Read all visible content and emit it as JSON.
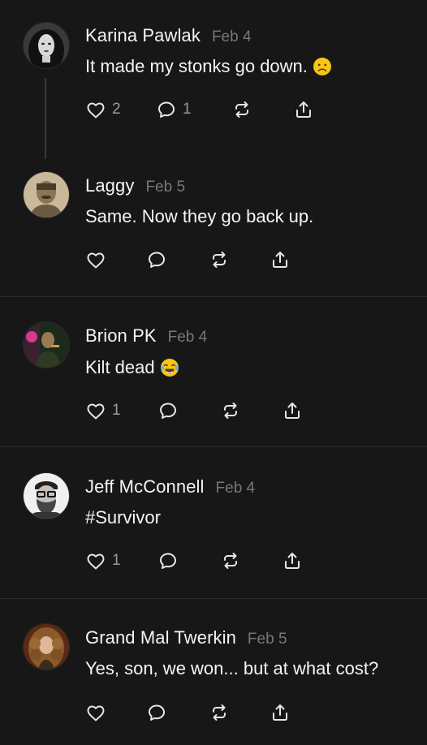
{
  "posts": [
    {
      "author": "Karina Pawlak",
      "date": "Feb 4",
      "text": "It made my stonks go down.",
      "emoji": "frowning-face",
      "likes": "2",
      "replies": "1",
      "avatar": "woman-dark-hair"
    },
    {
      "author": "Laggy",
      "date": "Feb 5",
      "text": "Same. Now they go back up.",
      "emoji": "",
      "likes": "",
      "replies": "",
      "avatar": "sepia-portrait"
    },
    {
      "author": "Brion PK",
      "date": "Feb 4",
      "text": "Kilt dead",
      "emoji": "tears-of-joy",
      "likes": "1",
      "replies": "",
      "avatar": "neon-figure"
    },
    {
      "author": "Jeff McConnell",
      "date": "Feb 4",
      "text": "#Survivor",
      "emoji": "",
      "likes": "1",
      "replies": "",
      "avatar": "bearded-man-glasses"
    },
    {
      "author": "Grand Mal Twerkin",
      "date": "Feb 5",
      "text": "Yes, son, we won... but at what cost?",
      "emoji": "",
      "likes": "",
      "replies": "",
      "avatar": "baroque-portrait"
    }
  ],
  "colors": {
    "background": "#171717",
    "text": "#f3f5f7",
    "muted": "#777777",
    "icon": "#e6e6e6"
  },
  "icons": [
    "heart-icon",
    "comment-icon",
    "repost-icon",
    "share-icon"
  ]
}
